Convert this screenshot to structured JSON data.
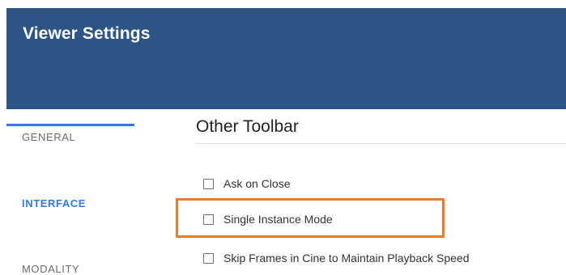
{
  "header": {
    "title": "Viewer Settings",
    "background_color": "#2c5485"
  },
  "sidebar": {
    "active_color": "#2f7ae0",
    "items": [
      {
        "label": "GENERAL",
        "active": false
      },
      {
        "label": "INTERFACE",
        "active": true
      },
      {
        "label": "MODALITY",
        "active": false
      }
    ]
  },
  "section": {
    "title": "Other Toolbar",
    "options": [
      {
        "label": "Ask on Close",
        "checked": false
      },
      {
        "label": "Single Instance Mode",
        "checked": false,
        "highlighted": true
      },
      {
        "label": "Skip Frames in Cine to Maintain Playback Speed",
        "checked": false
      }
    ]
  },
  "highlight_color": "#ee7a2d"
}
